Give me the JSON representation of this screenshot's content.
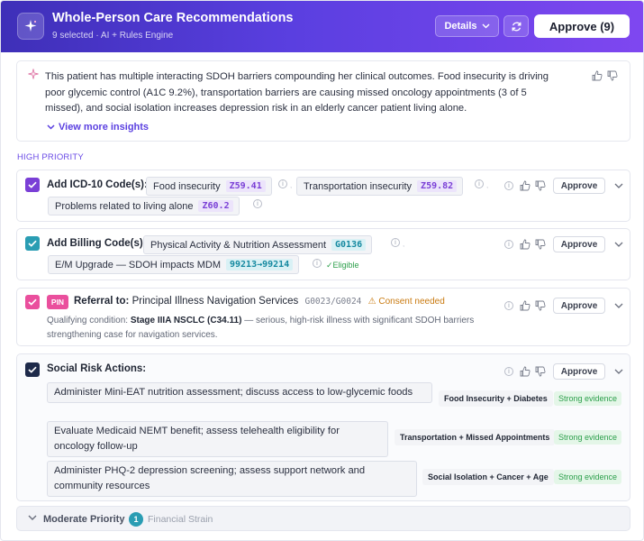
{
  "header": {
    "title": "Whole-Person Care Recommendations",
    "subtitle": "9 selected · AI + Rules Engine",
    "details_label": "Details",
    "approve_all_label": "Approve (9)"
  },
  "insight": {
    "text": "This patient has multiple interacting SDOH barriers compounding her clinical outcomes. Food insecurity is driving poor glycemic control (A1C 9.2%), transportation barriers are causing missed oncology appointments (3 of 5 missed), and social isolation increases depression risk in an elderly cancer patient living alone.",
    "view_more_label": "View more insights"
  },
  "section_label": "HIGH PRIORITY",
  "approve_label": "Approve",
  "icd": {
    "title": "Add ICD-10 Code(s):",
    "codes": [
      {
        "label": "Food insecurity",
        "code": "Z59.41"
      },
      {
        "label": "Transportation insecurity",
        "code": "Z59.82"
      },
      {
        "label": "Problems related to living alone",
        "code": "Z60.2"
      }
    ]
  },
  "billing": {
    "title": "Add Billing Code(s):",
    "codes": [
      {
        "label": "Physical Activity & Nutrition Assessment",
        "code": "G0136"
      },
      {
        "label": "E/M Upgrade — SDOH impacts MDM",
        "code": "99213→99214"
      }
    ],
    "eligible_label": "✓Eligible"
  },
  "referral": {
    "badge": "PIN",
    "prefix": "Referral to:",
    "service": "Principal Illness Navigation Services",
    "codes": "G0023/G0024",
    "consent": "Consent needed",
    "qual_prefix": "Qualifying condition:",
    "qual_condition": "Stage IIIA NSCLC (C34.11)",
    "qual_suffix": "— serious, high-risk illness with significant SDOH barriers strengthening case for navigation services."
  },
  "social": {
    "title": "Social Risk Actions:",
    "actions": [
      {
        "text": "Administer Mini-EAT nutrition assessment; discuss access to low-glycemic foods",
        "tag": "Food Insecurity + Diabetes",
        "evidence": "Strong evidence"
      },
      {
        "text": "Evaluate Medicaid NEMT benefit; assess telehealth eligibility for oncology follow-up",
        "tag": "Transportation + Missed Appointments",
        "evidence": "Strong evidence"
      },
      {
        "text": "Administer PHQ-2 depression screening; assess support network and community resources",
        "tag": "Social Isolation + Cancer + Age",
        "evidence": "Strong evidence"
      }
    ]
  },
  "moderate": {
    "label": "Moderate Priority",
    "count": "1",
    "sub": "Financial Strain"
  },
  "colors": {
    "header_start": "#3e2fb8",
    "header_end": "#7f47f0",
    "accent_purple": "#6a4be6",
    "icd_check": "#7a3fd6",
    "billing_check": "#2a9db3",
    "referral_check": "#ea4f9d",
    "social_check": "#1e2a4a",
    "evidence_green": "#2c9f4b",
    "consent_orange": "#c97a10"
  },
  "icons": [
    "sparkle-icon",
    "chevron-down-icon",
    "refresh-icon",
    "thumbs-up-icon",
    "thumbs-down-icon",
    "info-icon",
    "warning-icon",
    "check-icon"
  ]
}
